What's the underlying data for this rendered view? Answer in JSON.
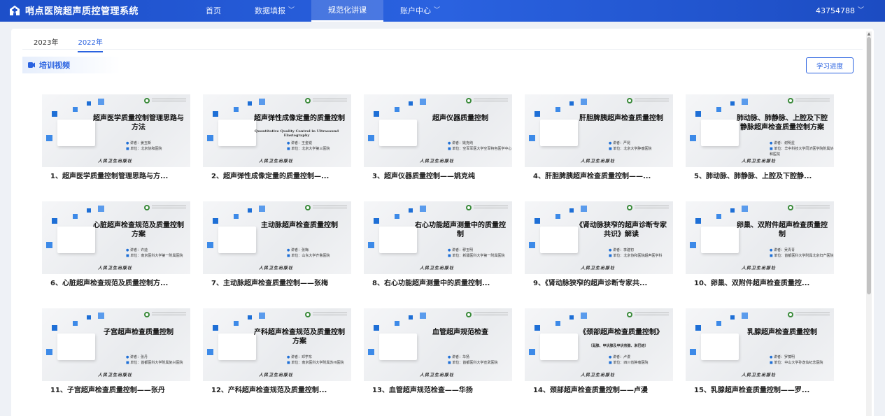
{
  "app": {
    "title": "哨点医院超声质控管理系统",
    "user": "43754788"
  },
  "nav": [
    {
      "label": "首页",
      "dropdown": false,
      "active": false
    },
    {
      "label": "数据填报",
      "dropdown": true,
      "active": false
    },
    {
      "label": "规范化讲课",
      "dropdown": false,
      "active": true
    },
    {
      "label": "账户中心",
      "dropdown": true,
      "active": false
    }
  ],
  "tabs": [
    {
      "label": "2023年",
      "active": false
    },
    {
      "label": "2022年",
      "active": true
    }
  ],
  "section": {
    "title": "培训视频",
    "progress_button": "学习进度"
  },
  "publisher": "人民卫生出版社",
  "videos": [
    {
      "caption": "1、超声医学质量控制管理思路与方...",
      "thumb_title": "超声医学质量控制管理思路与方法",
      "thumb_sub": "",
      "lecturer": "讲者：姜玉新",
      "unit": "单位：北京协和医院"
    },
    {
      "caption": "2、超声弹性成像定量的质量控制—...",
      "thumb_title": "超声弹性成像定量的质量控制",
      "thumb_sub": "Quantitative Quality Control in Ultrasound Elastography",
      "lecturer": "讲者：王金锐",
      "unit": "单位：北京大学第三医院"
    },
    {
      "caption": "3、超声仪器质量控制——姚克纯",
      "thumb_title": "超声仪器质量控制",
      "thumb_sub": "",
      "lecturer": "讲者：姚克纯",
      "unit": "单位：空军军医大学空军特色医学中心"
    },
    {
      "caption": "4、肝胆脾胰超声检查质量控制——...",
      "thumb_title": "肝胆脾胰超声检查质量控制",
      "thumb_sub": "",
      "lecturer": "讲者：严昆",
      "unit": "单位：北京大学肿瘤医院"
    },
    {
      "caption": "5、肺动脉、肺静脉、上腔及下腔静...",
      "thumb_title": "肺动脉、肺静脉、上腔及下腔静脉超声检查质量控制方案",
      "thumb_sub": "",
      "lecturer": "讲者：谢明星",
      "unit": "单位：华中科技大学同济医学院附属协和医院"
    },
    {
      "caption": "6、心脏超声检查规范及质量控制方...",
      "thumb_title": "心脏超声检查规范及质量控制方案",
      "thumb_sub": "",
      "lecturer": "讲者：许迪",
      "unit": "单位：南京医科大学第一附属医院"
    },
    {
      "caption": "7、主动脉超声检查质量控制——张梅",
      "thumb_title": "主动脉超声检查质量控制",
      "thumb_sub": "",
      "lecturer": "讲者：张梅",
      "unit": "单位：山东大学齐鲁医院"
    },
    {
      "caption": "8、右心功能超声测量中的质量控制...",
      "thumb_title": "右心功能超声测量中的质量控制",
      "thumb_sub": "",
      "lecturer": "讲者：穆玉明",
      "unit": "单位：新疆医科大学第一附属医院"
    },
    {
      "caption": "9、《肾动脉狭窄的超声诊断专家共...",
      "thumb_title": "《肾动脉狭窄的超声诊断专家共识》解读",
      "thumb_sub": "",
      "lecturer": "讲者：李建初",
      "unit": "单位：北京协和医院超声医学科"
    },
    {
      "caption": "10、卵巢、双附件超声检查质量控...",
      "thumb_title": "卵巢、双附件超声检查质量控制",
      "thumb_sub": "",
      "lecturer": "讲者：吴青青",
      "unit": "单位：首都医科大学附属北京妇产医院"
    },
    {
      "caption": "11、子宫超声检查质量控制——张丹",
      "thumb_title": "子宫超声检查质量控制",
      "thumb_sub": "",
      "lecturer": "讲者：张丹",
      "unit": "单位：首都医科大学附属复兴医院"
    },
    {
      "caption": "12、产科超声检查规范及质量控制...",
      "thumb_title": "产科超声检查规范及质量控制方案",
      "thumb_sub": "",
      "lecturer": "讲者：邓学东",
      "unit": "单位：南京医科大学附属苏州医院"
    },
    {
      "caption": "13、血管超声规范检查——华扬",
      "thumb_title": "血管超声规范检查",
      "thumb_sub": "",
      "lecturer": "讲者：华扬",
      "unit": "单位：首都医科大学宣武医院"
    },
    {
      "caption": "14、颈部超声检查质量控制——卢漫",
      "thumb_title": "《颈部超声检查质量控制》",
      "thumb_sub": "（涎腺、甲状腺及甲状旁腺、淋巴结）",
      "lecturer": "讲者：卢漫",
      "unit": "单位：四川省肿瘤医院"
    },
    {
      "caption": "15、乳腺超声检查质量控制——罗...",
      "thumb_title": "乳腺超声检查质量控制",
      "thumb_sub": "",
      "lecturer": "讲者：罗葆明",
      "unit": "单位：中山大学孙逸仙纪念医院"
    }
  ]
}
